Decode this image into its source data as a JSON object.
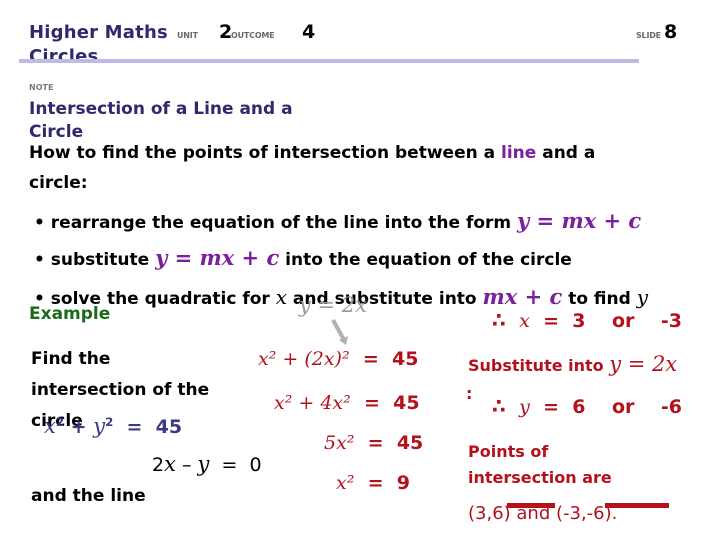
{
  "header": {
    "title_line1": "Higher Maths",
    "title_line2": "Circles",
    "unit_label": "UNIT",
    "unit_value": "2",
    "outcome_label": "OUTCOME",
    "outcome_value": "4",
    "slide_label": "SLIDE",
    "slide_value": "8"
  },
  "note": {
    "label": "NOTE",
    "title_line1": "Intersection of a Line and a",
    "title_line2": "Circle",
    "intro_before": "How to find the points of intersection between a ",
    "intro_highlight": "line",
    "intro_after": " and a",
    "intro_line2": "circle:"
  },
  "steps": [
    {
      "bullet": "•",
      "text_before": "rearrange the equation of the line into the form ",
      "math": "y = mx + c",
      "text_after": ""
    },
    {
      "bullet": "•",
      "text_before": "substitute ",
      "math": "y = mx + c",
      "text_after": " into the equation of the circle"
    },
    {
      "bullet": "•",
      "text_before": "solve the quadratic for ",
      "var_x": "x",
      "text_mid": " and substitute into ",
      "math": "mx + c",
      "text_after": " to find ",
      "var_y": "y"
    }
  ],
  "example": {
    "label": "Example",
    "problem_line1": "Find the",
    "problem_line2": "intersection of the",
    "problem_line3": "circle",
    "problem_line4": "and the line",
    "circle_eq": {
      "lhs_x": "x",
      "exp": "2",
      "plus": "+",
      "lhs_y": "y",
      "eq": "=",
      "rhs": "45"
    },
    "line_eq": {
      "coef": "2",
      "x": "x",
      "minus": "–",
      "y": "y",
      "eq": "=",
      "rhs": "0"
    },
    "rearranged_line": "y = 2x",
    "working": [
      {
        "lhs": "x² + (2x)²",
        "eq": "=",
        "rhs": "45"
      },
      {
        "lhs": "x² + 4x²",
        "eq": "=",
        "rhs": "45"
      },
      {
        "lhs": "5x²",
        "eq": "=",
        "rhs": "45"
      },
      {
        "lhs": "x²",
        "eq": "=",
        "rhs": "9"
      }
    ],
    "x_result": {
      "therefore": "∴",
      "var": "x",
      "eq": "=",
      "val1": "3",
      "or": "or",
      "val2": "-3"
    },
    "substitute_label": "Substitute into",
    "substitute_math": "y = 2x",
    "substitute_colon": ":",
    "y_result": {
      "therefore": "∴",
      "var": "y",
      "eq": "=",
      "val1": "6",
      "or": "or",
      "val2": "-6"
    },
    "points_line1": "Points of",
    "points_line2": "intersection are",
    "points_line3": "(3,6) and (-3,-6)."
  },
  "colors": {
    "title_navy": "#2e2a6e",
    "accent_purple": "#7a1f9e",
    "example_green": "#1a6b1a",
    "working_red": "#b3121c",
    "rule_lavender": "#bdbbe6"
  }
}
